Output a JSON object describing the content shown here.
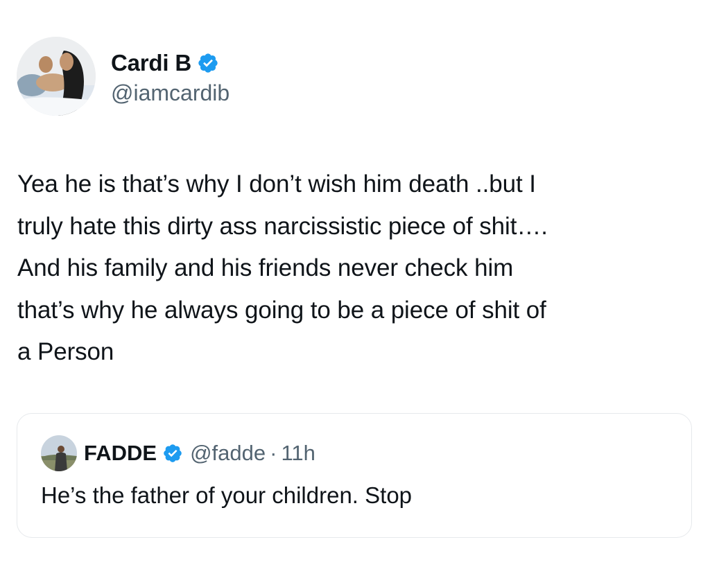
{
  "tweet": {
    "author": {
      "display_name": "Cardi B",
      "handle": "@iamcardib",
      "verified": true,
      "avatar_icon": "profile-photo"
    },
    "text_lines": [
      "Yea he is that’s why I don’t wish him death ..but I",
      "truly hate this dirty ass narcissistic piece of shit….",
      "And his family and his friends never check him",
      "that’s why he always going to be a piece of shit of",
      "a Person"
    ]
  },
  "quoted_tweet": {
    "author": {
      "display_name": "FADDE",
      "handle": "@fadde",
      "verified": true,
      "avatar_icon": "profile-photo"
    },
    "separator": "·",
    "time": "11h",
    "text": "He’s the father of your children. Stop"
  },
  "colors": {
    "text_primary": "#0f1419",
    "text_secondary": "#536471",
    "verified_blue": "#1d9bf0",
    "card_border": "#e6e9ec"
  }
}
